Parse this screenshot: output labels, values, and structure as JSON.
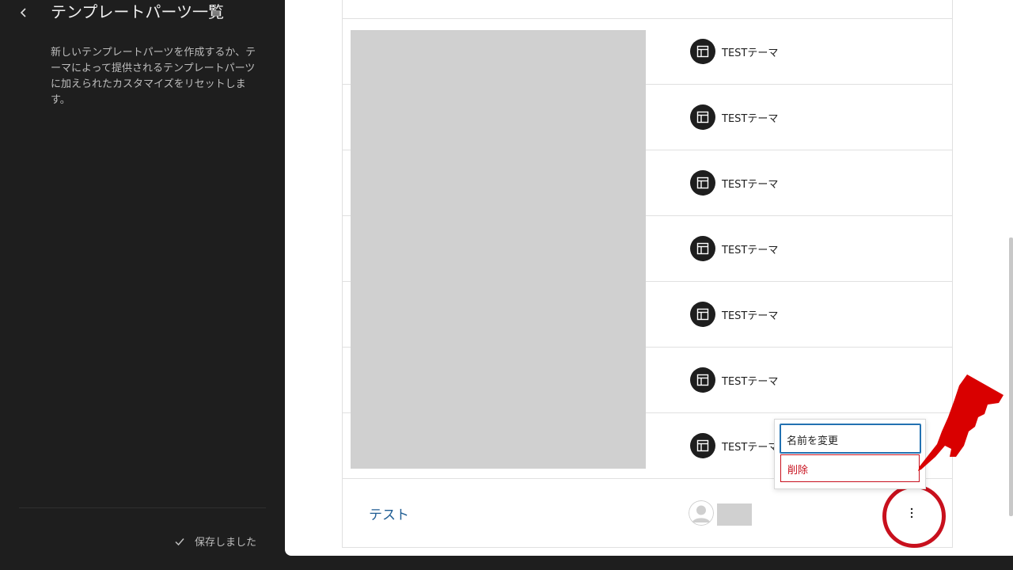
{
  "sidebar": {
    "title": "テンプレートパーツ一覧",
    "description": "新しいテンプレートパーツを作成するか、テーマによって提供されるテンプレートパーツに加えられたカスタマイズをリセットします。",
    "save_status": "保存しました"
  },
  "table": {
    "rows": [
      {
        "author": "TESTテーマ"
      },
      {
        "author": "TESTテーマ"
      },
      {
        "author": "TESTテーマ"
      },
      {
        "author": "TESTテーマ"
      },
      {
        "author": "TESTテーマ"
      },
      {
        "author": "TESTテーマ"
      },
      {
        "author": "TESTテーマ"
      }
    ],
    "bottom_row": {
      "name": "テスト"
    }
  },
  "dropdown": {
    "rename_label": "名前を変更",
    "delete_label": "削除"
  },
  "colors": {
    "accent": "#2271b1",
    "danger": "#c8101d",
    "link": "#1e5c93",
    "sidebar_bg": "#1e1e1e"
  },
  "icons": {
    "back": "chevron-left-icon",
    "theme": "layout-icon",
    "save": "check-icon",
    "more": "vertical-ellipsis-icon",
    "avatar": "user-avatar-icon"
  }
}
